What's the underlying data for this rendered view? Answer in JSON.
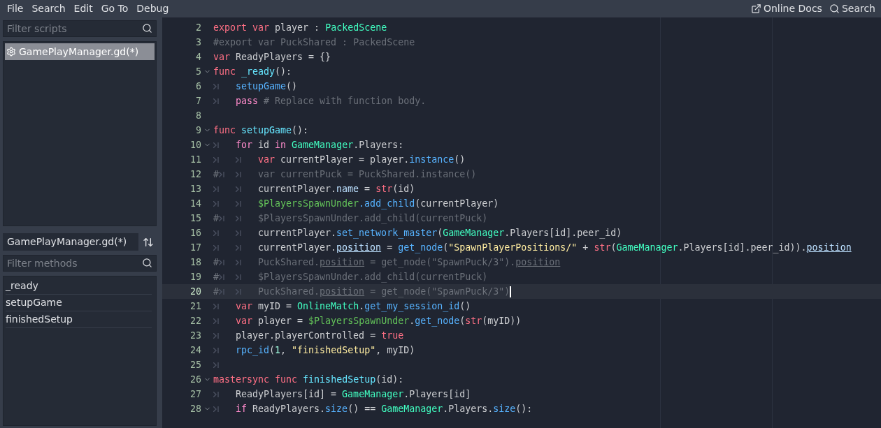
{
  "menu": [
    "File",
    "Search",
    "Edit",
    "Go To",
    "Debug"
  ],
  "top_right": [
    {
      "kind": "docs",
      "label": "Online Docs"
    },
    {
      "kind": "search",
      "label": "Search"
    }
  ],
  "scripts_filter": {
    "placeholder": "Filter scripts"
  },
  "scripts": [
    {
      "label": "GamePlayManager.gd(*)",
      "selected": true
    }
  ],
  "current_script": "GamePlayManager.gd(*)",
  "methods_filter": {
    "placeholder": "Filter methods"
  },
  "methods": [
    "_ready",
    "setupGame",
    "finishedSetup"
  ],
  "code": [
    {
      "num": "2",
      "fold": false,
      "current": false,
      "tokens": [
        {
          "kind": "kw",
          "text": "export var"
        },
        {
          "kind": "p",
          "text": " player : "
        },
        {
          "kind": "type",
          "text": "PackedScene"
        }
      ]
    },
    {
      "num": "3",
      "fold": false,
      "current": false,
      "tokens": [
        {
          "kind": "cm",
          "text": "#export var PuckShared : PackedScene"
        }
      ]
    },
    {
      "num": "4",
      "fold": false,
      "current": false,
      "tokens": [
        {
          "kind": "kw",
          "text": "var"
        },
        {
          "kind": "p",
          "text": " ReadyPlayers = {}"
        }
      ]
    },
    {
      "num": "5",
      "fold": true,
      "current": false,
      "tokens": [
        {
          "kind": "kw",
          "text": "func"
        },
        {
          "kind": "decl",
          "text": " _ready"
        },
        {
          "kind": "p",
          "text": "():"
        }
      ]
    },
    {
      "num": "6",
      "fold": false,
      "current": false,
      "tokens": [
        {
          "kind": "tab"
        },
        {
          "kind": "fn",
          "text": "setupGame"
        },
        {
          "kind": "p",
          "text": "()"
        }
      ]
    },
    {
      "num": "7",
      "fold": false,
      "current": false,
      "tokens": [
        {
          "kind": "tab"
        },
        {
          "kind": "ctrl",
          "text": "pass"
        },
        {
          "kind": "cm",
          "text": " # Replace with function body."
        }
      ]
    },
    {
      "num": "8",
      "fold": false,
      "current": false
    },
    {
      "num": "9",
      "fold": true,
      "current": false,
      "tokens": [
        {
          "kind": "kw",
          "text": "func"
        },
        {
          "kind": "decl",
          "text": " setupGame"
        },
        {
          "kind": "p",
          "text": "():"
        }
      ]
    },
    {
      "num": "10",
      "fold": true,
      "current": false,
      "tokens": [
        {
          "kind": "tab"
        },
        {
          "kind": "ctrl",
          "text": "for"
        },
        {
          "kind": "p",
          "text": " id "
        },
        {
          "kind": "ctrl",
          "text": "in"
        },
        {
          "kind": "type",
          "text": " GameManager"
        },
        {
          "kind": "p",
          "text": ".Players:"
        }
      ]
    },
    {
      "num": "11",
      "fold": false,
      "current": false,
      "tokens": [
        {
          "kind": "tab"
        },
        {
          "kind": "tab"
        },
        {
          "kind": "kw",
          "text": "var"
        },
        {
          "kind": "p",
          "text": " currentPlayer = player."
        },
        {
          "kind": "fn",
          "text": "instance"
        },
        {
          "kind": "p",
          "text": "()"
        }
      ]
    },
    {
      "num": "12",
      "fold": false,
      "current": false,
      "tokens": [
        {
          "kind": "hash",
          "text": "#"
        },
        {
          "kind": "tab"
        },
        {
          "kind": "tab"
        },
        {
          "kind": "cm",
          "text": "var currentPuck = PuckShared.instance()"
        }
      ]
    },
    {
      "num": "13",
      "fold": false,
      "current": false,
      "tokens": [
        {
          "kind": "tab"
        },
        {
          "kind": "tab"
        },
        {
          "kind": "p",
          "text": "currentPlayer."
        },
        {
          "kind": "mem",
          "text": "name"
        },
        {
          "kind": "p",
          "text": " = "
        },
        {
          "kind": "bi",
          "text": "str"
        },
        {
          "kind": "p",
          "text": "(id)"
        }
      ]
    },
    {
      "num": "14",
      "fold": false,
      "current": false,
      "tokens": [
        {
          "kind": "tab"
        },
        {
          "kind": "tab"
        },
        {
          "kind": "node",
          "text": "$PlayersSpawnUnder"
        },
        {
          "kind": "fn",
          "text": ".add_child"
        },
        {
          "kind": "p",
          "text": "(currentPlayer)"
        }
      ]
    },
    {
      "num": "15",
      "fold": false,
      "current": false,
      "tokens": [
        {
          "kind": "hash",
          "text": "#"
        },
        {
          "kind": "tab"
        },
        {
          "kind": "tab"
        },
        {
          "kind": "cm",
          "text": "$PlayersSpawnUnder.add_child(currentPuck)"
        }
      ]
    },
    {
      "num": "16",
      "fold": false,
      "current": false,
      "tokens": [
        {
          "kind": "tab"
        },
        {
          "kind": "tab"
        },
        {
          "kind": "p",
          "text": "currentPlayer."
        },
        {
          "kind": "fn",
          "text": "set_network_master"
        },
        {
          "kind": "p",
          "text": "("
        },
        {
          "kind": "type",
          "text": "GameManager"
        },
        {
          "kind": "p",
          "text": ".Players[id].peer_id)"
        }
      ]
    },
    {
      "num": "17",
      "fold": false,
      "current": false,
      "tokens": [
        {
          "kind": "tab"
        },
        {
          "kind": "tab"
        },
        {
          "kind": "p",
          "text": "currentPlayer."
        },
        {
          "kind": "memu",
          "text": "position"
        },
        {
          "kind": "p",
          "text": " = "
        },
        {
          "kind": "fn",
          "text": "get_node"
        },
        {
          "kind": "p",
          "text": "("
        },
        {
          "kind": "str",
          "text": "\"SpawnPlayerPositions/\""
        },
        {
          "kind": "p",
          "text": " + "
        },
        {
          "kind": "bi",
          "text": "str"
        },
        {
          "kind": "p",
          "text": "("
        },
        {
          "kind": "type",
          "text": "GameManager"
        },
        {
          "kind": "p",
          "text": ".Players[id].peer_id))."
        },
        {
          "kind": "memu",
          "text": "position"
        }
      ]
    },
    {
      "num": "18",
      "fold": false,
      "current": false,
      "tokens": [
        {
          "kind": "hash",
          "text": "#"
        },
        {
          "kind": "tab"
        },
        {
          "kind": "tab"
        },
        {
          "kind": "cm",
          "text": "PuckShared."
        },
        {
          "kind": "cmu",
          "text": "position"
        },
        {
          "kind": "cm",
          "text": " = get_node(\"SpawnPuck/3\")."
        },
        {
          "kind": "cmu",
          "text": "position"
        }
      ]
    },
    {
      "num": "19",
      "fold": false,
      "current": false,
      "tokens": [
        {
          "kind": "hash",
          "text": "#"
        },
        {
          "kind": "tab"
        },
        {
          "kind": "tab"
        },
        {
          "kind": "cm",
          "text": "$PlayersSpawnUnder.add_child(currentPuck)"
        }
      ]
    },
    {
      "num": "20",
      "fold": false,
      "current": true,
      "tokens": [
        {
          "kind": "hash",
          "text": "#"
        },
        {
          "kind": "tab"
        },
        {
          "kind": "tab"
        },
        {
          "kind": "cm",
          "text": "PuckShared."
        },
        {
          "kind": "cmu",
          "text": "position"
        },
        {
          "kind": "cm",
          "text": " = get_node(\"SpawnPuck/3\")"
        }
      ]
    },
    {
      "num": "21",
      "fold": false,
      "current": false,
      "tokens": [
        {
          "kind": "tab"
        },
        {
          "kind": "kw",
          "text": "var"
        },
        {
          "kind": "p",
          "text": " myID = "
        },
        {
          "kind": "type",
          "text": "OnlineMatch"
        },
        {
          "kind": "p",
          "text": "."
        },
        {
          "kind": "fn",
          "text": "get_my_session_id"
        },
        {
          "kind": "p",
          "text": "()"
        }
      ]
    },
    {
      "num": "22",
      "fold": false,
      "current": false,
      "tokens": [
        {
          "kind": "tab"
        },
        {
          "kind": "kw",
          "text": "var"
        },
        {
          "kind": "p",
          "text": " player = "
        },
        {
          "kind": "node",
          "text": "$PlayersSpawnUnder"
        },
        {
          "kind": "p",
          "text": "."
        },
        {
          "kind": "fn",
          "text": "get_node"
        },
        {
          "kind": "p",
          "text": "("
        },
        {
          "kind": "bi",
          "text": "str"
        },
        {
          "kind": "p",
          "text": "(myID))"
        }
      ]
    },
    {
      "num": "23",
      "fold": false,
      "current": false,
      "tokens": [
        {
          "kind": "tab"
        },
        {
          "kind": "p",
          "text": "player.playerControlled = "
        },
        {
          "kind": "kw",
          "text": "true"
        }
      ]
    },
    {
      "num": "24",
      "fold": false,
      "current": false,
      "tokens": [
        {
          "kind": "tab"
        },
        {
          "kind": "fn",
          "text": "rpc_id"
        },
        {
          "kind": "p",
          "text": "("
        },
        {
          "kind": "num",
          "text": "1"
        },
        {
          "kind": "p",
          "text": ", "
        },
        {
          "kind": "str",
          "text": "\"finishedSetup\""
        },
        {
          "kind": "p",
          "text": ", myID)"
        }
      ]
    },
    {
      "num": "25",
      "fold": false,
      "current": false,
      "tokens": [
        {
          "kind": "tab"
        }
      ]
    },
    {
      "num": "26",
      "fold": true,
      "current": false,
      "tokens": [
        {
          "kind": "kw",
          "text": "mastersync func"
        },
        {
          "kind": "decl",
          "text": " finishedSetup"
        },
        {
          "kind": "p",
          "text": "(id):"
        }
      ]
    },
    {
      "num": "27",
      "fold": false,
      "current": false,
      "tokens": [
        {
          "kind": "tab"
        },
        {
          "kind": "p",
          "text": "ReadyPlayers[id] = "
        },
        {
          "kind": "type",
          "text": "GameManager"
        },
        {
          "kind": "p",
          "text": ".Players[id]"
        }
      ]
    },
    {
      "num": "28",
      "fold": true,
      "current": false,
      "tokens": [
        {
          "kind": "tab"
        },
        {
          "kind": "ctrl",
          "text": "if"
        },
        {
          "kind": "p",
          "text": " ReadyPlayers."
        },
        {
          "kind": "fn",
          "text": "size"
        },
        {
          "kind": "p",
          "text": "() == "
        },
        {
          "kind": "type",
          "text": "GameManager"
        },
        {
          "kind": "p",
          "text": ".Players."
        },
        {
          "kind": "fn",
          "text": "size"
        },
        {
          "kind": "p",
          "text": "():"
        }
      ]
    }
  ]
}
